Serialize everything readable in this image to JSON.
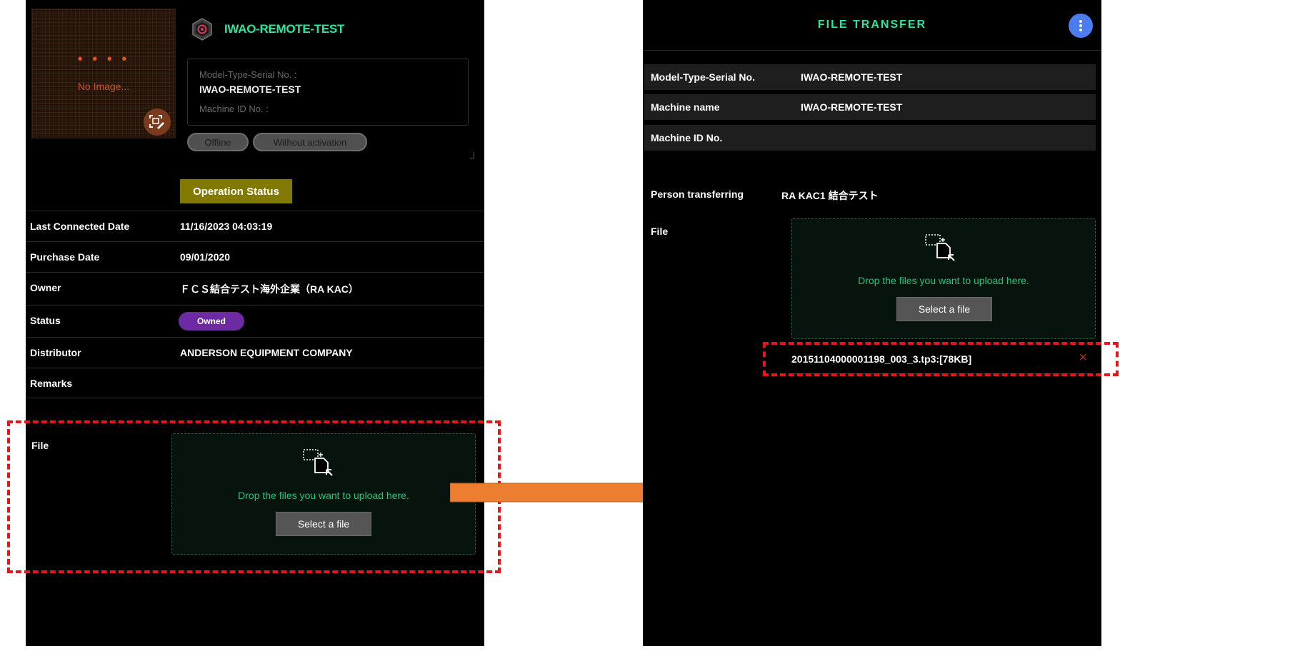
{
  "left": {
    "thumbnail": {
      "dots": "• • • •",
      "text": "No Image..."
    },
    "machine": {
      "title": "IWAO-REMOTE-TEST",
      "model_label": "Model-Type-Serial No. :",
      "model_value": "IWAO-REMOTE-TEST",
      "machine_id_label": "Machine ID No. :"
    },
    "badges": {
      "offline": "Offline",
      "activation": "Without activation"
    },
    "operation_status": "Operation Status",
    "details": [
      {
        "label": "Last Connected Date",
        "value": "11/16/2023 04:03:19"
      },
      {
        "label": "Purchase Date",
        "value": "09/01/2020"
      },
      {
        "label": "Owner",
        "value": "ＦＣＳ結合テスト海外企業（RA KAC）"
      },
      {
        "label": "Status",
        "value": "Owned"
      },
      {
        "label": "Distributor",
        "value": "ANDERSON EQUIPMENT COMPANY"
      },
      {
        "label": "Remarks",
        "value": ""
      }
    ],
    "file": {
      "label": "File",
      "drop_text": "Drop the files you want to upload here.",
      "select_button": "Select a file"
    }
  },
  "right": {
    "title": "FILE TRANSFER",
    "rows": [
      {
        "label": "Model-Type-Serial No.",
        "value": "IWAO-REMOTE-TEST"
      },
      {
        "label": "Machine name",
        "value": "IWAO-REMOTE-TEST"
      },
      {
        "label": "Machine ID No.",
        "value": ""
      }
    ],
    "person_label": "Person transferring",
    "person_value": "RA KAC1 結合テスト",
    "file_label": "File",
    "drop_text": "Drop the files you want to upload here.",
    "select_button": "Select a file",
    "uploaded_file": "20151104000001198_003_3.tp3:[78KB]",
    "remove_icon": "×"
  },
  "colors": {
    "accent_green": "#2be6a2",
    "owned_purple": "#6d2aa2",
    "operation_status_olive": "#827a00",
    "highlight_red": "#e8141a",
    "arrow_orange": "#ed7d31",
    "menu_blue": "#4b7df0"
  }
}
